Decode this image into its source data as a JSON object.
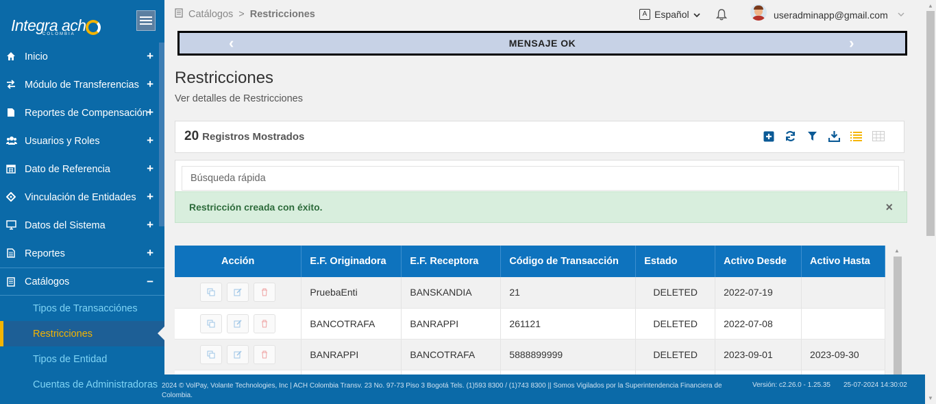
{
  "brand": {
    "name": "Integra ach",
    "subtitle": "COLOMBIA"
  },
  "sidebar": {
    "items": [
      {
        "label": "Inicio",
        "icon": "home-icon",
        "toggle": "+"
      },
      {
        "label": "Módulo de Transferencias",
        "icon": "transfer-icon",
        "toggle": "+"
      },
      {
        "label": "Reportes de Compensación",
        "icon": "file-icon",
        "toggle": "+"
      },
      {
        "label": "Usuarios y Roles",
        "icon": "users-icon",
        "toggle": "+"
      },
      {
        "label": "Dato de Referencia",
        "icon": "calendar-icon",
        "toggle": "+"
      },
      {
        "label": "Vinculación de Entidades",
        "icon": "link-icon",
        "toggle": "+"
      },
      {
        "label": "Datos del Sistema",
        "icon": "monitor-icon",
        "toggle": "+"
      },
      {
        "label": "Reportes",
        "icon": "report-icon",
        "toggle": "+"
      },
      {
        "label": "Catálogos",
        "icon": "book-icon",
        "toggle": "−"
      }
    ],
    "subitems": [
      {
        "label": "Tipos de Transacciónes"
      },
      {
        "label": "Restricciones"
      },
      {
        "label": "Tipos de Entidad"
      },
      {
        "label": "Cuentas de Administradoras"
      }
    ]
  },
  "header": {
    "breadcrumb": {
      "parent": "Catálogos",
      "separator": ">",
      "current": "Restricciones"
    },
    "language": "Español",
    "user_email": "useradminapp@gmail.com"
  },
  "banner": {
    "text": "MENSAJE OK",
    "left_arrow": "‹",
    "right_arrow": "›"
  },
  "page": {
    "title": "Restricciones",
    "subtitle": "Ver detalles de Restricciones"
  },
  "toolbar": {
    "count": "20",
    "count_label": "Registros Mostrados"
  },
  "search": {
    "placeholder": "Búsqueda rápida"
  },
  "alert": {
    "text": "Restricción creada con éxito.",
    "close": "×"
  },
  "table": {
    "headers": [
      "Acción",
      "E.F. Originadora",
      "E.F. Receptora",
      "Código de Transacción",
      "Estado",
      "Activo Desde",
      "Activo Hasta"
    ],
    "rows": [
      [
        "PruebaEnti",
        "BANSKANDIA",
        "21",
        "DELETED",
        "2022-07-19",
        ""
      ],
      [
        "BANCOTRAFA",
        "BANRAPPI",
        "261121",
        "DELETED",
        "2022-07-08",
        ""
      ],
      [
        "BANRAPPI",
        "BANCOTRAFA",
        "5888899999",
        "DELETED",
        "2023-09-01",
        "2023-09-30"
      ],
      [
        "",
        "",
        "",
        "",
        "",
        ""
      ]
    ]
  },
  "footer": {
    "text": "2024 © VolPay, Volante Technologies, Inc | ACH Colombia Transv. 23 No. 97-73 Piso 3 Bogotá Tels. (1)593 8300 / (1)743 8300 || Somos Vigilados por la Superintendencia Financiera de Colombia.",
    "version": "Versión: c2.26.0 - 1.25.35",
    "datetime": "25-07-2024 14:30:02"
  },
  "colors": {
    "primary": "#0b6aa8",
    "header_table": "#0e73be",
    "accent": "#f5b400",
    "success_bg": "#d8eedd"
  }
}
